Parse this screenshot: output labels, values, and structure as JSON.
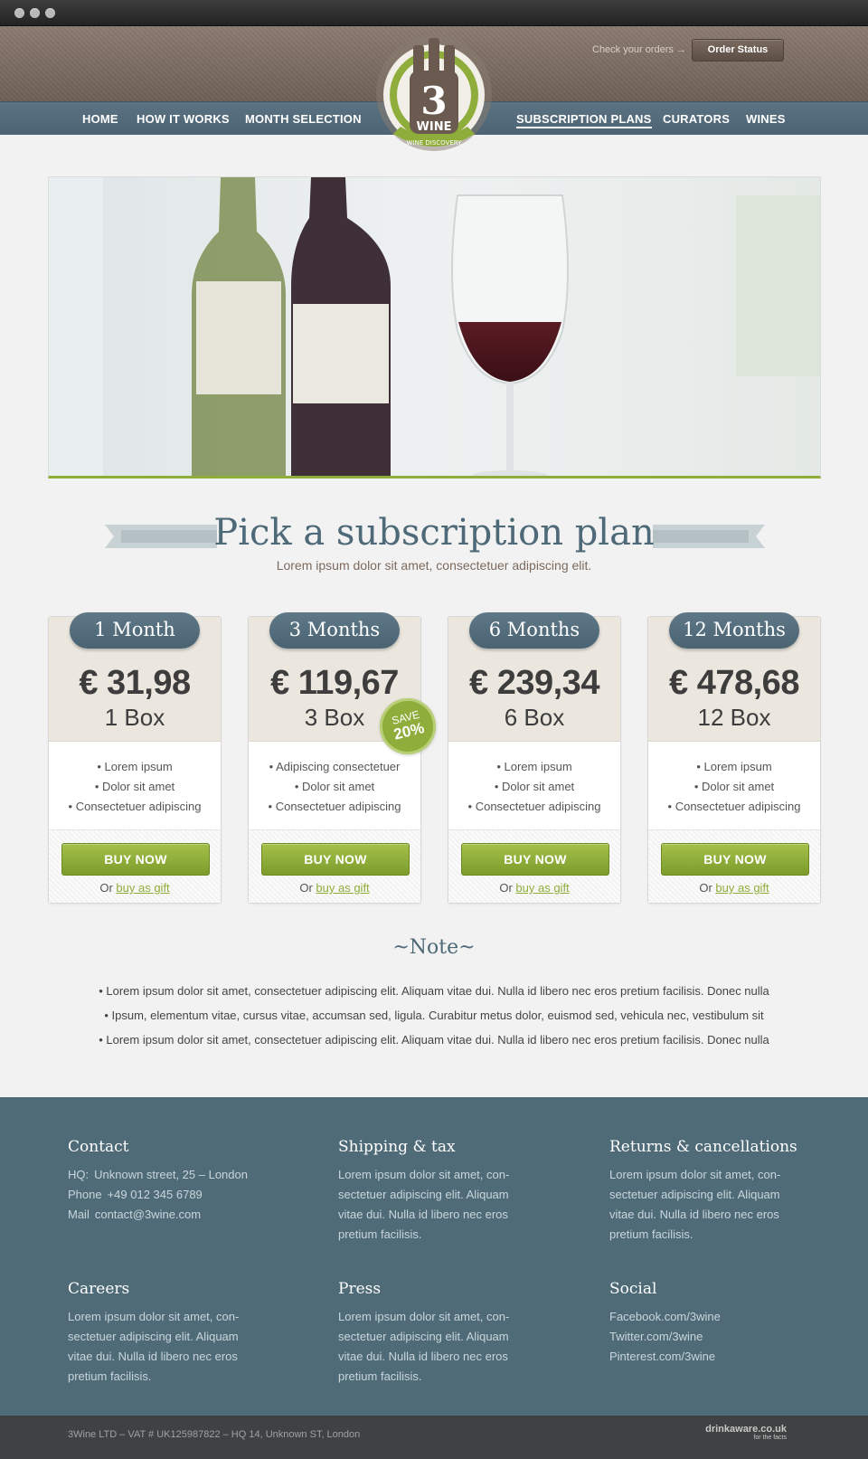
{
  "header": {
    "orders_label": "Check your orders →",
    "order_status_button": "Order Status",
    "logo": {
      "number": "3",
      "word": "WINE",
      "tagline": "WINE DISCOVERY"
    }
  },
  "nav": {
    "left": [
      "HOME",
      "HOW IT WORKS",
      "MONTH SELECTION"
    ],
    "right": [
      "SUBSCRIPTION PLANS",
      "CURATORS",
      "WINES"
    ],
    "active": "SUBSCRIPTION PLANS"
  },
  "plans_section": {
    "title": "Pick a subscription plan",
    "subtitle": "Lorem ipsum dolor sit amet, consectetuer adipiscing elit."
  },
  "plans": [
    {
      "duration": "1 Month",
      "price": "€ 31,98",
      "box": "1 Box",
      "features": [
        "• Lorem ipsum",
        "• Dolor sit amet",
        "• Consectetuer adipiscing"
      ],
      "buy": "BUY NOW",
      "or": "Or",
      "gift": "buy as gift"
    },
    {
      "duration": "3 Months",
      "price": "€ 119,67",
      "box": "3 Box",
      "features": [
        "• Adipiscing consectetuer",
        "• Dolor sit amet",
        "• Consectetuer adipiscing"
      ],
      "buy": "BUY NOW",
      "or": "Or",
      "gift": "buy as gift"
    },
    {
      "duration": "6 Months",
      "price": "€ 239,34",
      "box": "6 Box",
      "features": [
        "• Lorem ipsum",
        "• Dolor sit amet",
        "• Consectetuer adipiscing"
      ],
      "buy": "BUY NOW",
      "or": "Or",
      "gift": "buy as gift"
    },
    {
      "duration": "12 Months",
      "price": "€ 478,68",
      "box": "12 Box",
      "features": [
        "• Lorem ipsum",
        "• Dolor sit amet",
        "• Consectetuer adipiscing"
      ],
      "buy": "BUY NOW",
      "or": "Or",
      "gift": "buy as gift"
    }
  ],
  "save_badge": {
    "line1": "SAVE",
    "line2": "20%"
  },
  "note": {
    "title": "~Note~",
    "lines": [
      "• Lorem ipsum dolor sit amet, consectetuer adipiscing elit. Aliquam vitae dui. Nulla id libero nec eros pretium facilisis. Donec nulla",
      "• Ipsum, elementum vitae, cursus vitae, accumsan sed, ligula. Curabitur metus dolor, euismod sed, vehicula nec, vestibulum sit",
      "• Lorem ipsum dolor sit amet, consectetuer adipiscing elit. Aliquam vitae dui. Nulla id libero nec eros pretium facilisis. Donec nulla"
    ]
  },
  "footer": {
    "contact": {
      "title": "Contact",
      "hq_label": "HQ:",
      "hq": "Unknown street, 25 – London",
      "phone_label": "Phone",
      "phone": "+49 012 345 6789",
      "mail_label": "Mail",
      "mail": "contact@3wine.com"
    },
    "shipping": {
      "title": "Shipping & tax",
      "lines": [
        "Lorem ipsum dolor sit amet, con-",
        "sectetuer adipiscing elit. Aliquam",
        "vitae dui. Nulla id libero nec eros",
        "pretium facilisis."
      ]
    },
    "returns": {
      "title": "Returns & cancellations",
      "lines": [
        "Lorem ipsum dolor sit amet, con-",
        "sectetuer adipiscing elit. Aliquam",
        "vitae dui. Nulla id libero nec eros",
        "pretium facilisis."
      ]
    },
    "careers": {
      "title": "Careers",
      "lines": [
        "Lorem ipsum dolor sit amet, con-",
        "sectetuer adipiscing elit. Aliquam",
        "vitae dui. Nulla id libero nec eros",
        "pretium facilisis."
      ]
    },
    "press": {
      "title": "Press",
      "lines": [
        "Lorem ipsum dolor sit amet, con-",
        "sectetuer adipiscing elit. Aliquam",
        "vitae dui. Nulla id libero nec eros",
        "pretium facilisis."
      ]
    },
    "social": {
      "title": "Social",
      "links": [
        "Facebook.com/3wine",
        "Twitter.com/3wine",
        "Pinterest.com/3wine"
      ]
    },
    "legal": "3Wine LTD – VAT # UK125987822 – HQ 14, Unknown ST, London",
    "drinkaware": "drinkaware.co.uk",
    "drinkaware_tag": "for the facts"
  },
  "colors": {
    "nav_blue": "#4f6b77",
    "brand_green": "#8fad3a",
    "header_brown": "#7b6b60",
    "title_slate": "#4e6977"
  }
}
